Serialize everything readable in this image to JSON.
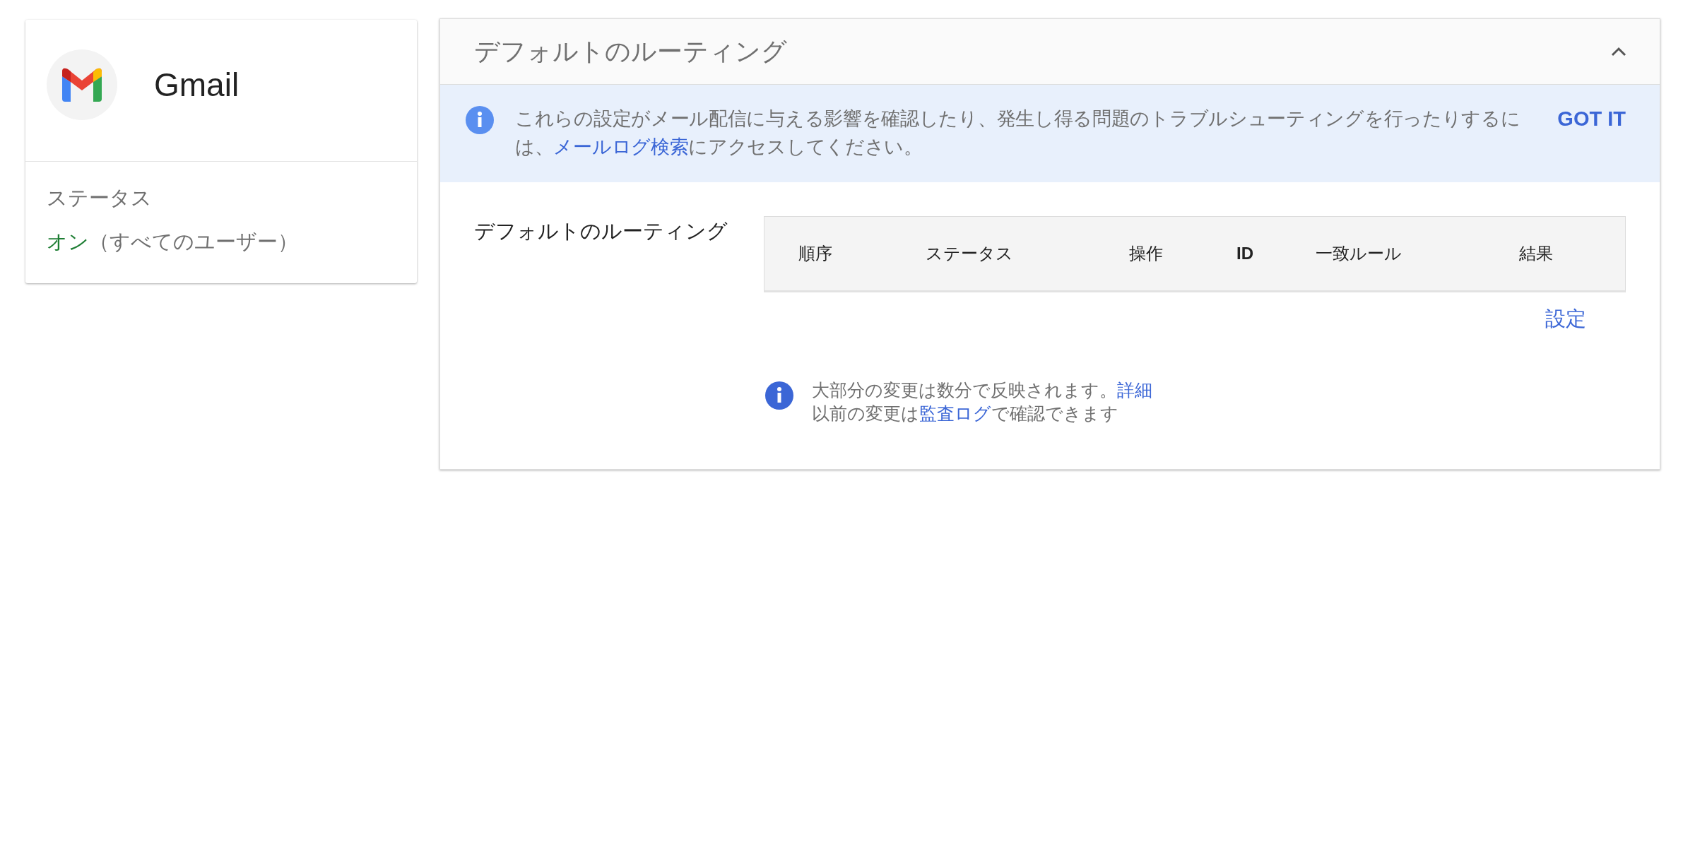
{
  "app_card": {
    "name": "Gmail",
    "status_label": "ステータス",
    "status_value": "オン",
    "status_scope": "（すべてのユーザー）",
    "status_on": true
  },
  "panel": {
    "title": "デフォルトのルーティング",
    "expanded": true,
    "banner": {
      "parts": [
        {
          "kind": "text",
          "text": "これらの設定がメール配信に与える影響を確認したり、発生し得る問題のトラブルシューティングを行ったりするには、"
        },
        {
          "kind": "link",
          "text": "メールログ検索"
        },
        {
          "kind": "text",
          "text": "にアクセスしてください。"
        }
      ],
      "button": "GOT IT"
    },
    "section_label": "デフォルトのルーティング",
    "table": {
      "columns": [
        {
          "label": "順序"
        },
        {
          "label": "ステータス"
        },
        {
          "label": "操作"
        },
        {
          "label": "ID",
          "bold": true
        },
        {
          "label": "一致ルール"
        },
        {
          "label": "結果"
        }
      ]
    },
    "configure_link": "設定",
    "note": {
      "lines": [
        [
          {
            "kind": "text",
            "text": "大部分の変更は数分で反映されます。"
          },
          {
            "kind": "link",
            "text": "詳細"
          }
        ],
        [
          {
            "kind": "text",
            "text": "以前の変更は"
          },
          {
            "kind": "link",
            "text": "監査ログ"
          },
          {
            "kind": "text",
            "text": "で確認できます"
          }
        ]
      ]
    }
  }
}
